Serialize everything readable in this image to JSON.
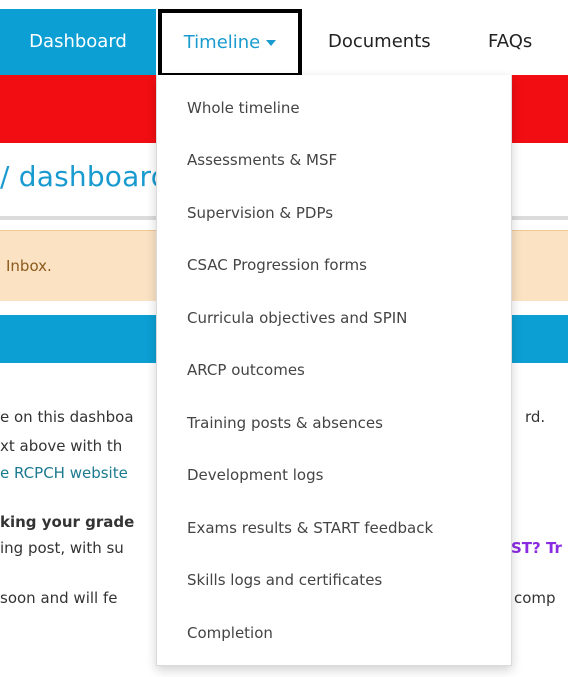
{
  "nav": {
    "dashboard": "Dashboard",
    "timeline": "Timeline",
    "documents": "Documents",
    "faqs": "FAQs"
  },
  "page": {
    "title_fragment": "dashboard",
    "alert_fragment": "Inbox."
  },
  "body_fragments": {
    "line1_left": "e on this dashboa",
    "line1_right": "rd.",
    "line2_left": "xt above with th",
    "line3_left": "e RCPCH website",
    "line4_left": "king your grade",
    "line5_left": "ing post, with su",
    "line5_right": "ST? Tr",
    "line6_left": "soon and will fe",
    "line6_right": "comp"
  },
  "dropdown": {
    "items": [
      "Whole timeline",
      "Assessments & MSF",
      "Supervision & PDPs",
      "CSAC Progression forms",
      "Curricula objectives and SPIN",
      "ARCP outcomes",
      "Training posts & absences",
      "Development logs",
      "Exams results & START feedback",
      "Skills logs and certificates",
      "Completion"
    ]
  },
  "colors": {
    "nav_blue": "#0c9fd4",
    "red_band": "#f20d12",
    "alert_bg": "#fbe2c3",
    "purple_text": "#8a2be2"
  }
}
